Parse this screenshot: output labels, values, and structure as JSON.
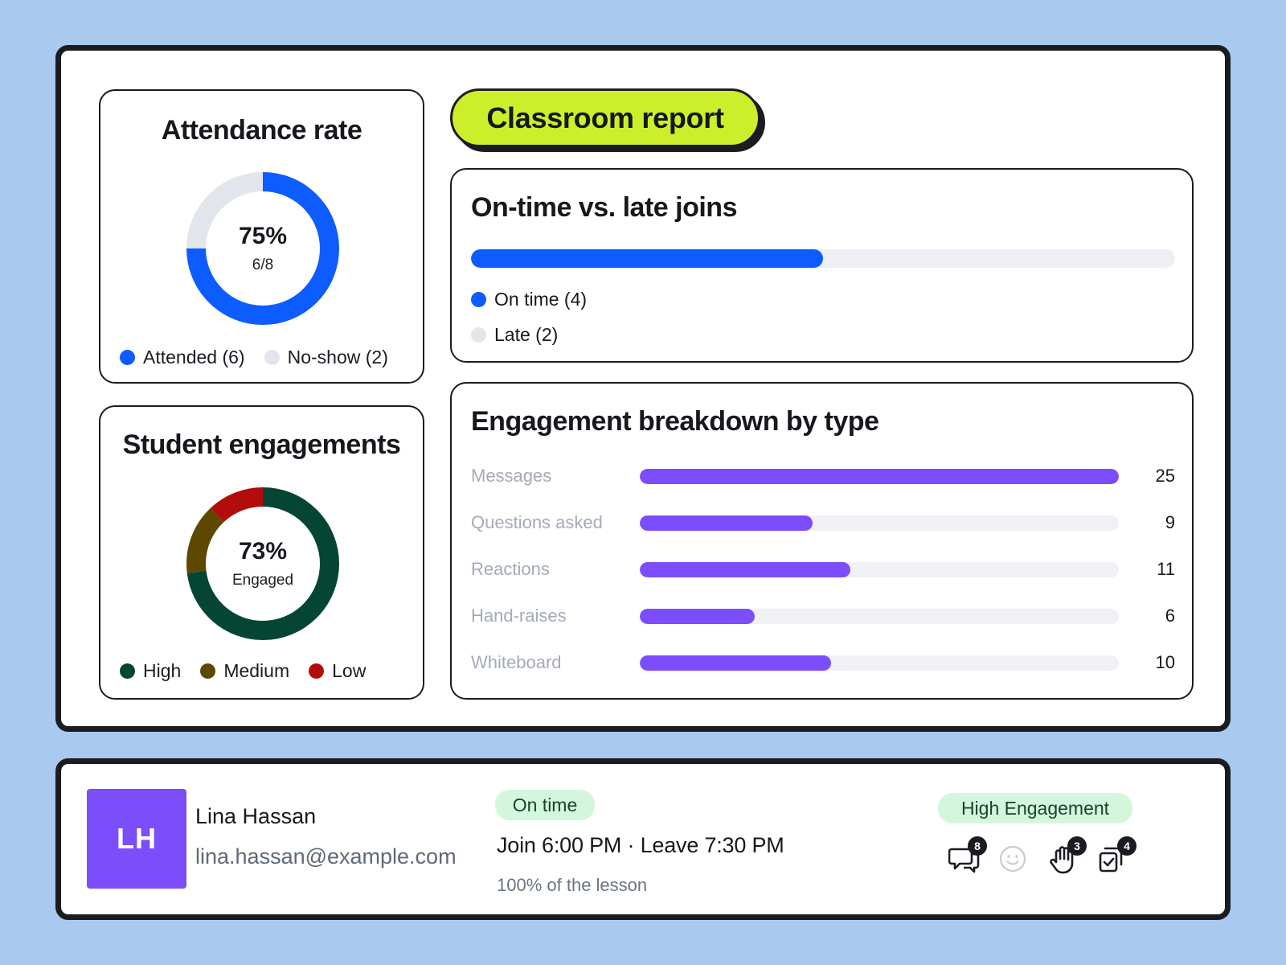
{
  "page": {
    "title": "Classroom report"
  },
  "attendance": {
    "title": "Attendance rate",
    "percent_label": "75%",
    "sub_label": "6/8",
    "legend": [
      {
        "label": "Attended (6)",
        "color": "#0c5cff"
      },
      {
        "label": "No-show (2)",
        "color": "#e3e5ec"
      }
    ]
  },
  "engagements": {
    "title": "Student engagements",
    "percent_label": "73%",
    "sub_label": "Engaged",
    "legend": [
      {
        "label": "High",
        "color": "#054534"
      },
      {
        "label": "Medium",
        "color": "#5e4800"
      },
      {
        "label": "Low",
        "color": "#b30c0c"
      }
    ]
  },
  "ontime": {
    "title": "On-time vs. late joins",
    "legend": [
      {
        "label": "On time (4)",
        "color": "#0c5cff"
      },
      {
        "label": "Late (2)",
        "color": "#e3e5ec"
      }
    ]
  },
  "breakdown": {
    "title": "Engagement breakdown by type"
  },
  "chart_data": [
    {
      "type": "pie",
      "title": "Attendance rate",
      "categories": [
        "Attended",
        "No-show"
      ],
      "values": [
        6,
        2
      ],
      "colors": [
        "#0c5cff",
        "#e3e5ec"
      ],
      "donut": true,
      "center_text": [
        "75%",
        "6/8"
      ]
    },
    {
      "type": "pie",
      "title": "Student engagements",
      "categories": [
        "High",
        "Medium",
        "Low"
      ],
      "values": [
        73,
        15,
        12
      ],
      "colors": [
        "#054534",
        "#5e4800",
        "#b30c0c"
      ],
      "donut": true,
      "center_text": [
        "73%",
        "Engaged"
      ]
    },
    {
      "type": "bar",
      "title": "On-time vs. late joins",
      "orientation": "horizontal-stacked",
      "categories": [
        "On time",
        "Late"
      ],
      "values": [
        4,
        2
      ],
      "colors": [
        "#0c5cff",
        "#e3e5ec"
      ]
    },
    {
      "type": "bar",
      "title": "Engagement breakdown by type",
      "orientation": "horizontal",
      "categories": [
        "Messages",
        "Questions asked",
        "Reactions",
        "Hand-raises",
        "Whiteboard"
      ],
      "values": [
        25,
        9,
        11,
        6,
        10
      ],
      "xlim": [
        0,
        25
      ],
      "color": "#7b4dfb"
    }
  ],
  "student": {
    "initials": "LH",
    "name": "Lina Hassan",
    "email": "lina.hassan@example.com",
    "status": "On time",
    "times": "Join 6:00 PM · Leave 7:30 PM",
    "lesson_share": "100% of the lesson",
    "engagement_level": "High Engagement",
    "activity": [
      {
        "icon": "chat-bubbles-icon",
        "count": "8"
      },
      {
        "icon": "smiley-icon",
        "count": ""
      },
      {
        "icon": "raised-hand-icon",
        "count": "3"
      },
      {
        "icon": "whiteboard-check-icon",
        "count": "4"
      }
    ]
  }
}
